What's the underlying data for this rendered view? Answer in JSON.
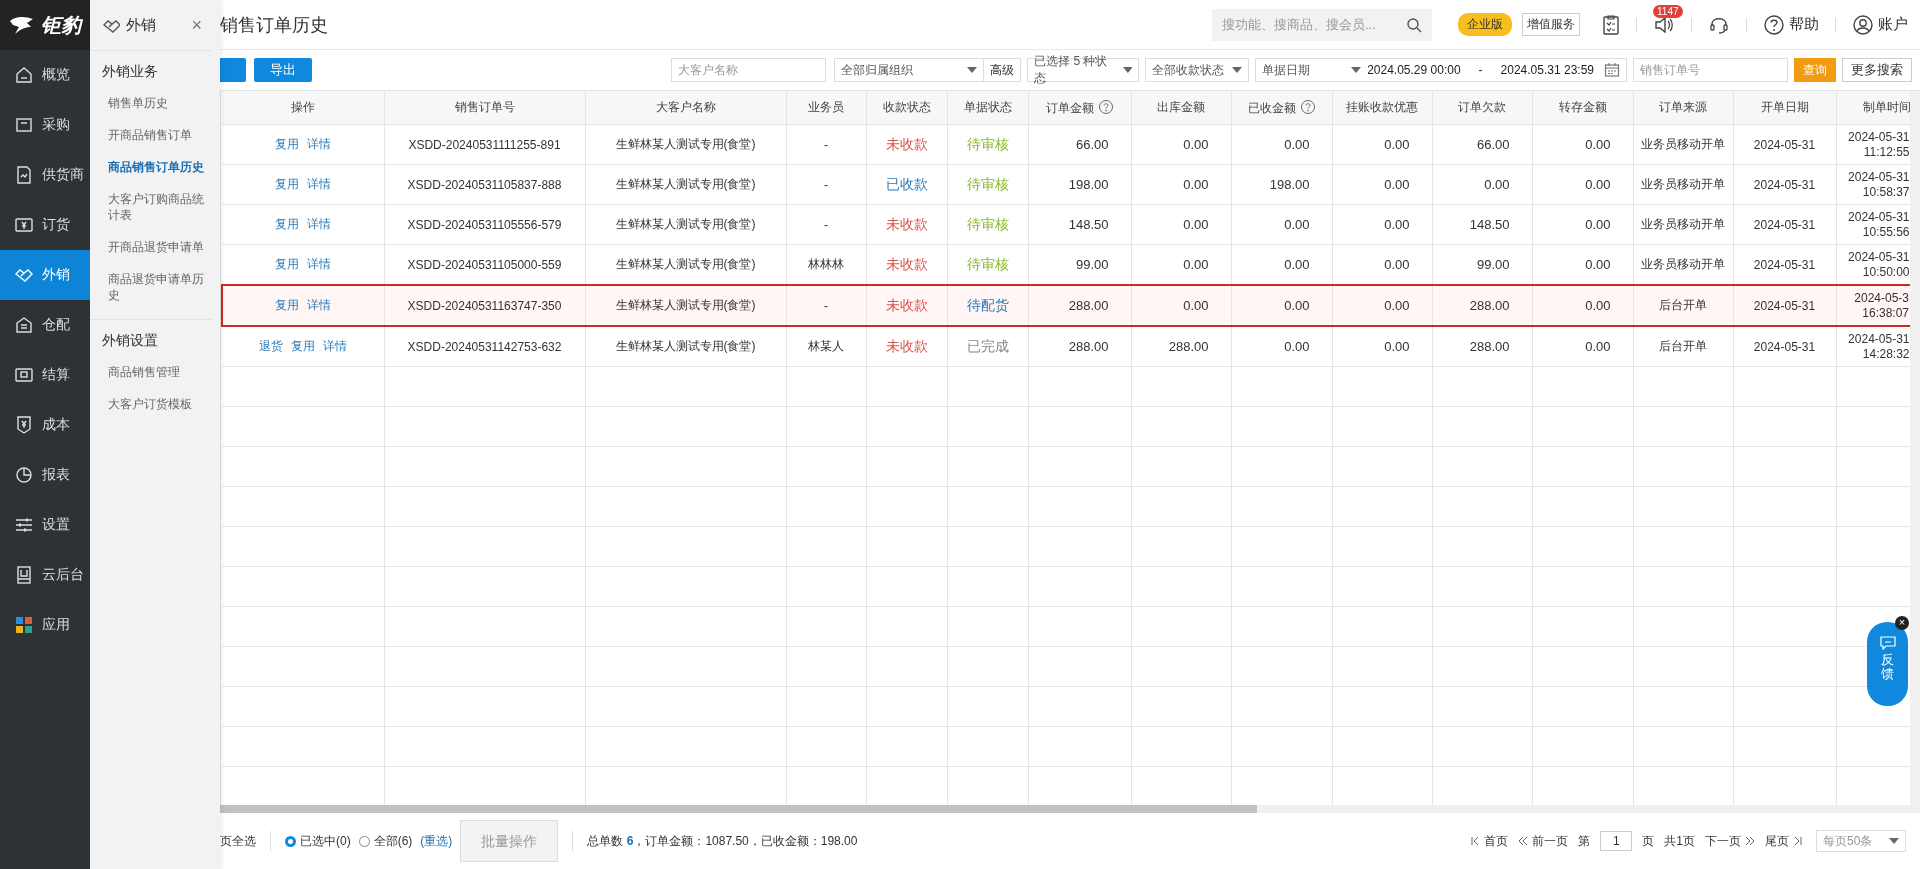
{
  "brand": {
    "name": "钜豹"
  },
  "sidebar": {
    "items": [
      {
        "label": "概览",
        "selected": false
      },
      {
        "label": "采购",
        "selected": false
      },
      {
        "label": "供货商",
        "selected": false
      },
      {
        "label": "订货",
        "selected": false
      },
      {
        "label": "外销",
        "selected": true
      },
      {
        "label": "仓配",
        "selected": false
      },
      {
        "label": "结算",
        "selected": false
      },
      {
        "label": "成本",
        "selected": false
      },
      {
        "label": "报表",
        "selected": false
      },
      {
        "label": "设置",
        "selected": false
      },
      {
        "label": "云后台",
        "selected": false
      },
      {
        "label": "应用",
        "selected": false
      }
    ]
  },
  "submenu": {
    "title": "外销",
    "close": "×",
    "sections": [
      {
        "title": "外销业务",
        "items": [
          {
            "label": "销售单历史",
            "selected": false
          },
          {
            "label": "开商品销售订单",
            "selected": false
          },
          {
            "label": "商品销售订单历史",
            "selected": true
          },
          {
            "label": "大客户订购商品统计表",
            "selected": false
          },
          {
            "label": "开商品退货申请单",
            "selected": false
          },
          {
            "label": "商品退货申请单历史",
            "selected": false
          }
        ]
      },
      {
        "title": "外销设置",
        "items": [
          {
            "label": "商品销售管理",
            "selected": false
          },
          {
            "label": "大客户订货模板",
            "selected": false
          }
        ]
      }
    ]
  },
  "page_title": "销售订单历史",
  "topbar": {
    "search": {
      "placeholder": "搜功能、搜商品、搜会员..."
    },
    "edition_badge": "企业版",
    "value_added": "增值服务",
    "notification_count": "1147",
    "help": "帮助",
    "account": "账户"
  },
  "toolbar": {
    "export": "导出",
    "customer_field": {
      "placeholder": "大客户名称"
    },
    "org_select": "全部归属组织",
    "advanced": "高级",
    "status_select": "已选择 5 种状态",
    "payment_select": "全部收款状态",
    "date_type_select": "单据日期",
    "date_from": "2024.05.29 00:00",
    "date_sep": "-",
    "date_to": "2024.05.31 23:59",
    "order_field": {
      "placeholder": "销售订单号"
    },
    "query": "查询",
    "more_search": "更多搜索"
  },
  "table": {
    "columns": [
      {
        "label": "操作",
        "kind": "plain"
      },
      {
        "label": "销售订单号",
        "kind": "plain"
      },
      {
        "label": "大客户名称",
        "kind": "plain"
      },
      {
        "label": "业务员",
        "kind": "plain"
      },
      {
        "label": "收款状态",
        "kind": "plain"
      },
      {
        "label": "单据状态",
        "kind": "plain"
      },
      {
        "label": "订单金额",
        "kind": "help"
      },
      {
        "label": "出库金额",
        "kind": "plain"
      },
      {
        "label": "已收金额",
        "kind": "help"
      },
      {
        "label": "挂账收款优惠",
        "kind": "plain"
      },
      {
        "label": "订单欠款",
        "kind": "plain"
      },
      {
        "label": "转存金额",
        "kind": "plain"
      },
      {
        "label": "订单来源",
        "kind": "plain"
      },
      {
        "label": "开单日期",
        "kind": "plain"
      },
      {
        "label": "制单时间",
        "kind": "plain"
      }
    ],
    "rows": [
      {
        "highlighted": false,
        "actions": [
          "复用",
          "详情"
        ],
        "order_no": "XSDD-20240531111255-891",
        "customer": "生鲜林某人测试专用(食堂)",
        "salesman": "-",
        "payment_status": {
          "text": "未收款",
          "color": "#d9534f"
        },
        "doc_status": {
          "text": "待审核",
          "color": "#8cb82b"
        },
        "amounts": [
          "66.00",
          "0.00",
          "0.00",
          "0.00",
          "66.00",
          "0.00"
        ],
        "source": "业务员移动开单",
        "open_date": "2024-05-31",
        "created": "2024-05-31 11:12:55"
      },
      {
        "highlighted": false,
        "actions": [
          "复用",
          "详情"
        ],
        "order_no": "XSDD-20240531105837-888",
        "customer": "生鲜林某人测试专用(食堂)",
        "salesman": "-",
        "payment_status": {
          "text": "已收款",
          "color": "#2a7ab8"
        },
        "doc_status": {
          "text": "待审核",
          "color": "#8cb82b"
        },
        "amounts": [
          "198.00",
          "0.00",
          "198.00",
          "0.00",
          "0.00",
          "0.00"
        ],
        "source": "业务员移动开单",
        "open_date": "2024-05-31",
        "created": "2024-05-31 10:58:37"
      },
      {
        "highlighted": false,
        "actions": [
          "复用",
          "详情"
        ],
        "order_no": "XSDD-20240531105556-579",
        "customer": "生鲜林某人测试专用(食堂)",
        "salesman": "-",
        "payment_status": {
          "text": "未收款",
          "color": "#d9534f"
        },
        "doc_status": {
          "text": "待审核",
          "color": "#8cb82b"
        },
        "amounts": [
          "148.50",
          "0.00",
          "0.00",
          "0.00",
          "148.50",
          "0.00"
        ],
        "source": "业务员移动开单",
        "open_date": "2024-05-31",
        "created": "2024-05-31 10:55:56"
      },
      {
        "highlighted": false,
        "actions": [
          "复用",
          "详情"
        ],
        "order_no": "XSDD-20240531105000-559",
        "customer": "生鲜林某人测试专用(食堂)",
        "salesman": "林林林",
        "payment_status": {
          "text": "未收款",
          "color": "#d9534f"
        },
        "doc_status": {
          "text": "待审核",
          "color": "#8cb82b"
        },
        "amounts": [
          "99.00",
          "0.00",
          "0.00",
          "0.00",
          "99.00",
          "0.00"
        ],
        "source": "业务员移动开单",
        "open_date": "2024-05-31",
        "created": "2024-05-31 10:50:00"
      },
      {
        "highlighted": true,
        "actions": [
          "复用",
          "详情"
        ],
        "order_no": "XSDD-20240531163747-350",
        "customer": "生鲜林某人测试专用(食堂)",
        "salesman": "-",
        "payment_status": {
          "text": "未收款",
          "color": "#d9534f"
        },
        "doc_status": {
          "text": "待配货",
          "color": "#2a7ab8"
        },
        "amounts": [
          "288.00",
          "0.00",
          "0.00",
          "0.00",
          "288.00",
          "0.00"
        ],
        "source": "后台开单",
        "open_date": "2024-05-31",
        "created": "2024-05-3 16:38:07"
      },
      {
        "highlighted": false,
        "actions": [
          "退货",
          "复用",
          "详情"
        ],
        "order_no": "XSDD-20240531142753-632",
        "customer": "生鲜林某人测试专用(食堂)",
        "salesman": "林某人",
        "payment_status": {
          "text": "未收款",
          "color": "#d9534f"
        },
        "doc_status": {
          "text": "已完成",
          "color": "#888888"
        },
        "amounts": [
          "288.00",
          "288.00",
          "0.00",
          "0.00",
          "288.00",
          "0.00"
        ],
        "source": "后台开单",
        "open_date": "2024-05-31",
        "created": "2024-05-31 14:28:32"
      }
    ]
  },
  "footer": {
    "select_page": "页全选",
    "radios": [
      {
        "label": "已选中(0)",
        "selected": true
      },
      {
        "label": "全部(6)",
        "selected": false
      }
    ],
    "reselect": "(重选)",
    "batch": {
      "label": "批量操作",
      "disabled": true
    },
    "summary": "总单数 **6**，订单金额：1087.50，已收金额：198.00",
    "pager": {
      "first": "首页",
      "prev": "前一页",
      "page_prefix": "第",
      "page": "1",
      "page_suffix": "页",
      "total": "共1页",
      "next": "下一页",
      "last": "尾页",
      "page_size": "每页50条"
    }
  },
  "feedback": {
    "label": "反馈",
    "close": "×"
  }
}
